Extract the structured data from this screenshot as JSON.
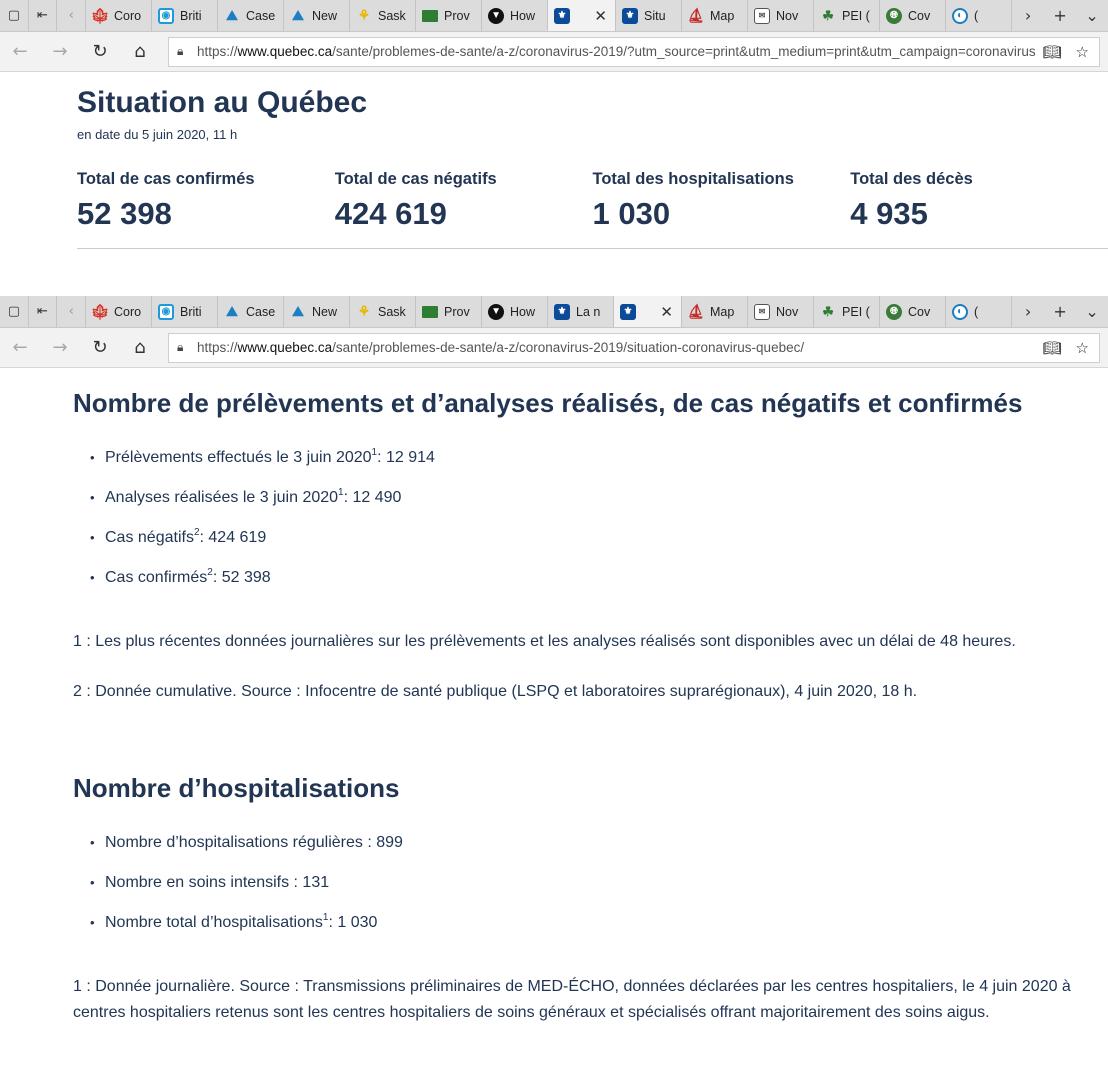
{
  "window1": {
    "tabs": [
      {
        "label": "Coro",
        "icon": "canada-flag-icon"
      },
      {
        "label": "Briti",
        "icon": "bc-icon"
      },
      {
        "label": "Case",
        "icon": "alberta-icon"
      },
      {
        "label": "New",
        "icon": "alberta-icon"
      },
      {
        "label": "Sask",
        "icon": "saskatchewan-icon"
      },
      {
        "label": "Prov",
        "icon": "manitoba-icon"
      },
      {
        "label": "How",
        "icon": "ontario-icon"
      },
      {
        "label": "",
        "icon": "quebec-fleurdelis-icon",
        "active": true
      },
      {
        "label": "Situ",
        "icon": "quebec-fleurdelis-icon"
      },
      {
        "label": "Map",
        "icon": "new-brunswick-icon"
      },
      {
        "label": "Nov",
        "icon": "nova-scotia-icon"
      },
      {
        "label": "PEI (",
        "icon": "pei-icon"
      },
      {
        "label": "Cov",
        "icon": "globe-icon"
      },
      {
        "label": "(",
        "icon": "newfoundland-icon"
      }
    ],
    "url_host": "www.quebec.ca",
    "url_prefix": "https://",
    "url_path": "/sante/problemes-de-sante/a-z/coronavirus-2019/?utm_source=print&utm_medium=print&utm_campaign=coronavirus"
  },
  "window2": {
    "tabs": [
      {
        "label": "Coro",
        "icon": "canada-flag-icon"
      },
      {
        "label": "Briti",
        "icon": "bc-icon"
      },
      {
        "label": "Case",
        "icon": "alberta-icon"
      },
      {
        "label": "New",
        "icon": "alberta-icon"
      },
      {
        "label": "Sask",
        "icon": "saskatchewan-icon"
      },
      {
        "label": "Prov",
        "icon": "manitoba-icon"
      },
      {
        "label": "How",
        "icon": "ontario-icon"
      },
      {
        "label": "La n",
        "icon": "quebec-fleurdelis-icon"
      },
      {
        "label": "",
        "icon": "quebec-fleurdelis-icon",
        "active": true
      },
      {
        "label": "Map",
        "icon": "new-brunswick-icon"
      },
      {
        "label": "Nov",
        "icon": "nova-scotia-icon"
      },
      {
        "label": "PEI (",
        "icon": "pei-icon"
      },
      {
        "label": "Cov",
        "icon": "globe-icon"
      },
      {
        "label": "(",
        "icon": "newfoundland-icon"
      }
    ],
    "url_host": "www.quebec.ca",
    "url_prefix": "https://",
    "url_path": "/sante/problemes-de-sante/a-z/coronavirus-2019/situation-coronavirus-quebec/"
  },
  "situation": {
    "title": "Situation au Québec",
    "date": "en date du 5 juin 2020, 11 h",
    "stats": [
      {
        "label": "Total de cas confirmés",
        "value": "52 398"
      },
      {
        "label": "Total de cas négatifs",
        "value": "424 619"
      },
      {
        "label": "Total des hospitalisations",
        "value": "1 030"
      },
      {
        "label": "Total des décès",
        "value": "4 935"
      }
    ]
  },
  "tests_section": {
    "heading": "Nombre de prélèvements et d’analyses réalisés, de cas négatifs et confirmés",
    "items": [
      {
        "text": "Prélèvements effectués le 3 juin 2020",
        "sup": "1",
        "value": " : 12 914"
      },
      {
        "text": "Analyses réalisées le 3 juin 2020",
        "sup": "1",
        "value": " : 12 490"
      },
      {
        "text": "Cas négatifs",
        "sup": "2",
        "value": " : 424 619"
      },
      {
        "text": "Cas confirmés",
        "sup": "2",
        "value": " : 52 398"
      }
    ],
    "note1": "1 : Les plus récentes données journalières sur les prélèvements et les analyses réalisés sont disponibles avec un délai de 48 heures.",
    "note2": "2 : Donnée cumulative. Source : Infocentre de santé publique (LSPQ et laboratoires suprarégionaux), 4 juin 2020, 18 h."
  },
  "hosp_section": {
    "heading": "Nombre d’hospitalisations",
    "items": [
      {
        "text": "Nombre d’hospitalisations régulières : 899",
        "sup": "",
        "value": ""
      },
      {
        "text": "Nombre en soins intensifs : 131",
        "sup": "",
        "value": ""
      },
      {
        "text": "Nombre total d’hospitalisations",
        "sup": "1",
        "value": " : 1 030"
      }
    ],
    "note_line1": "1 : Donnée journalière. Source : Transmissions préliminaires de MED-ÉCHO, données déclarées par les centres hospitaliers, le 4 juin 2020 à",
    "note_line2": "centres hospitaliers retenus sont les centres hospitaliers de soins généraux et spécialisés offrant majoritairement des soins aigus."
  }
}
